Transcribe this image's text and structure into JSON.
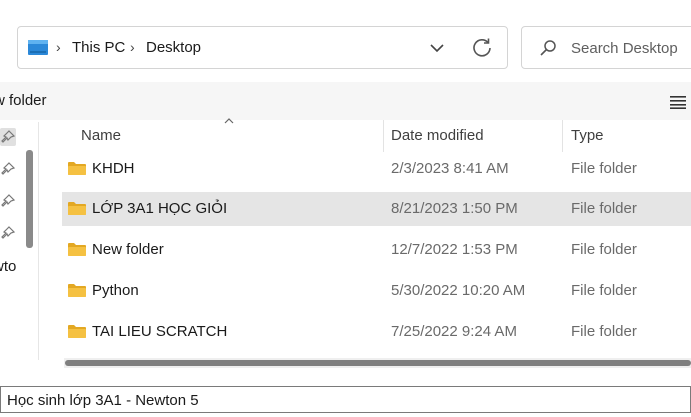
{
  "address_bar": {
    "breadcrumbs": [
      {
        "label": "This PC"
      },
      {
        "label": "Desktop"
      }
    ],
    "icons": {
      "location": "this-pc-icon",
      "separator": "chevron-right-icon",
      "dropdown": "chevron-down-icon",
      "refresh": "refresh-icon"
    }
  },
  "search": {
    "placeholder": "Search Desktop",
    "icon": "search-icon"
  },
  "toolbar": {
    "new_folder_label": "w folder",
    "view_icon": "details-view-icon"
  },
  "nav_pane": {
    "pins": 4,
    "partial_label": "wto"
  },
  "file_list": {
    "columns": {
      "name": "Name",
      "date": "Date modified",
      "type": "Type"
    },
    "sort": {
      "column": "name",
      "direction": "ascending"
    },
    "rows": [
      {
        "name": "KHDH",
        "date": "2/3/2023 8:41 AM",
        "type": "File folder",
        "selected": false
      },
      {
        "name": "LỚP 3A1 HỌC GIỎI",
        "date": "8/21/2023 1:50 PM",
        "type": "File folder",
        "selected": true
      },
      {
        "name": "New folder",
        "date": "12/7/2022 1:53 PM",
        "type": "File folder",
        "selected": false
      },
      {
        "name": "Python",
        "date": "5/30/2022 10:20 AM",
        "type": "File folder",
        "selected": false
      },
      {
        "name": "TAI LIEU SCRATCH",
        "date": "7/25/2022 9:24 AM",
        "type": "File folder",
        "selected": false
      }
    ]
  },
  "filename_field": {
    "value": "Học sinh lớp 3A1 - Newton 5"
  },
  "colors": {
    "folder": "#F5C142",
    "folder_dark": "#E3A823",
    "pc_icon": "#2B88D8",
    "selected_row": "#E5E5E5",
    "toolbar_bg": "#F6F6F6"
  }
}
